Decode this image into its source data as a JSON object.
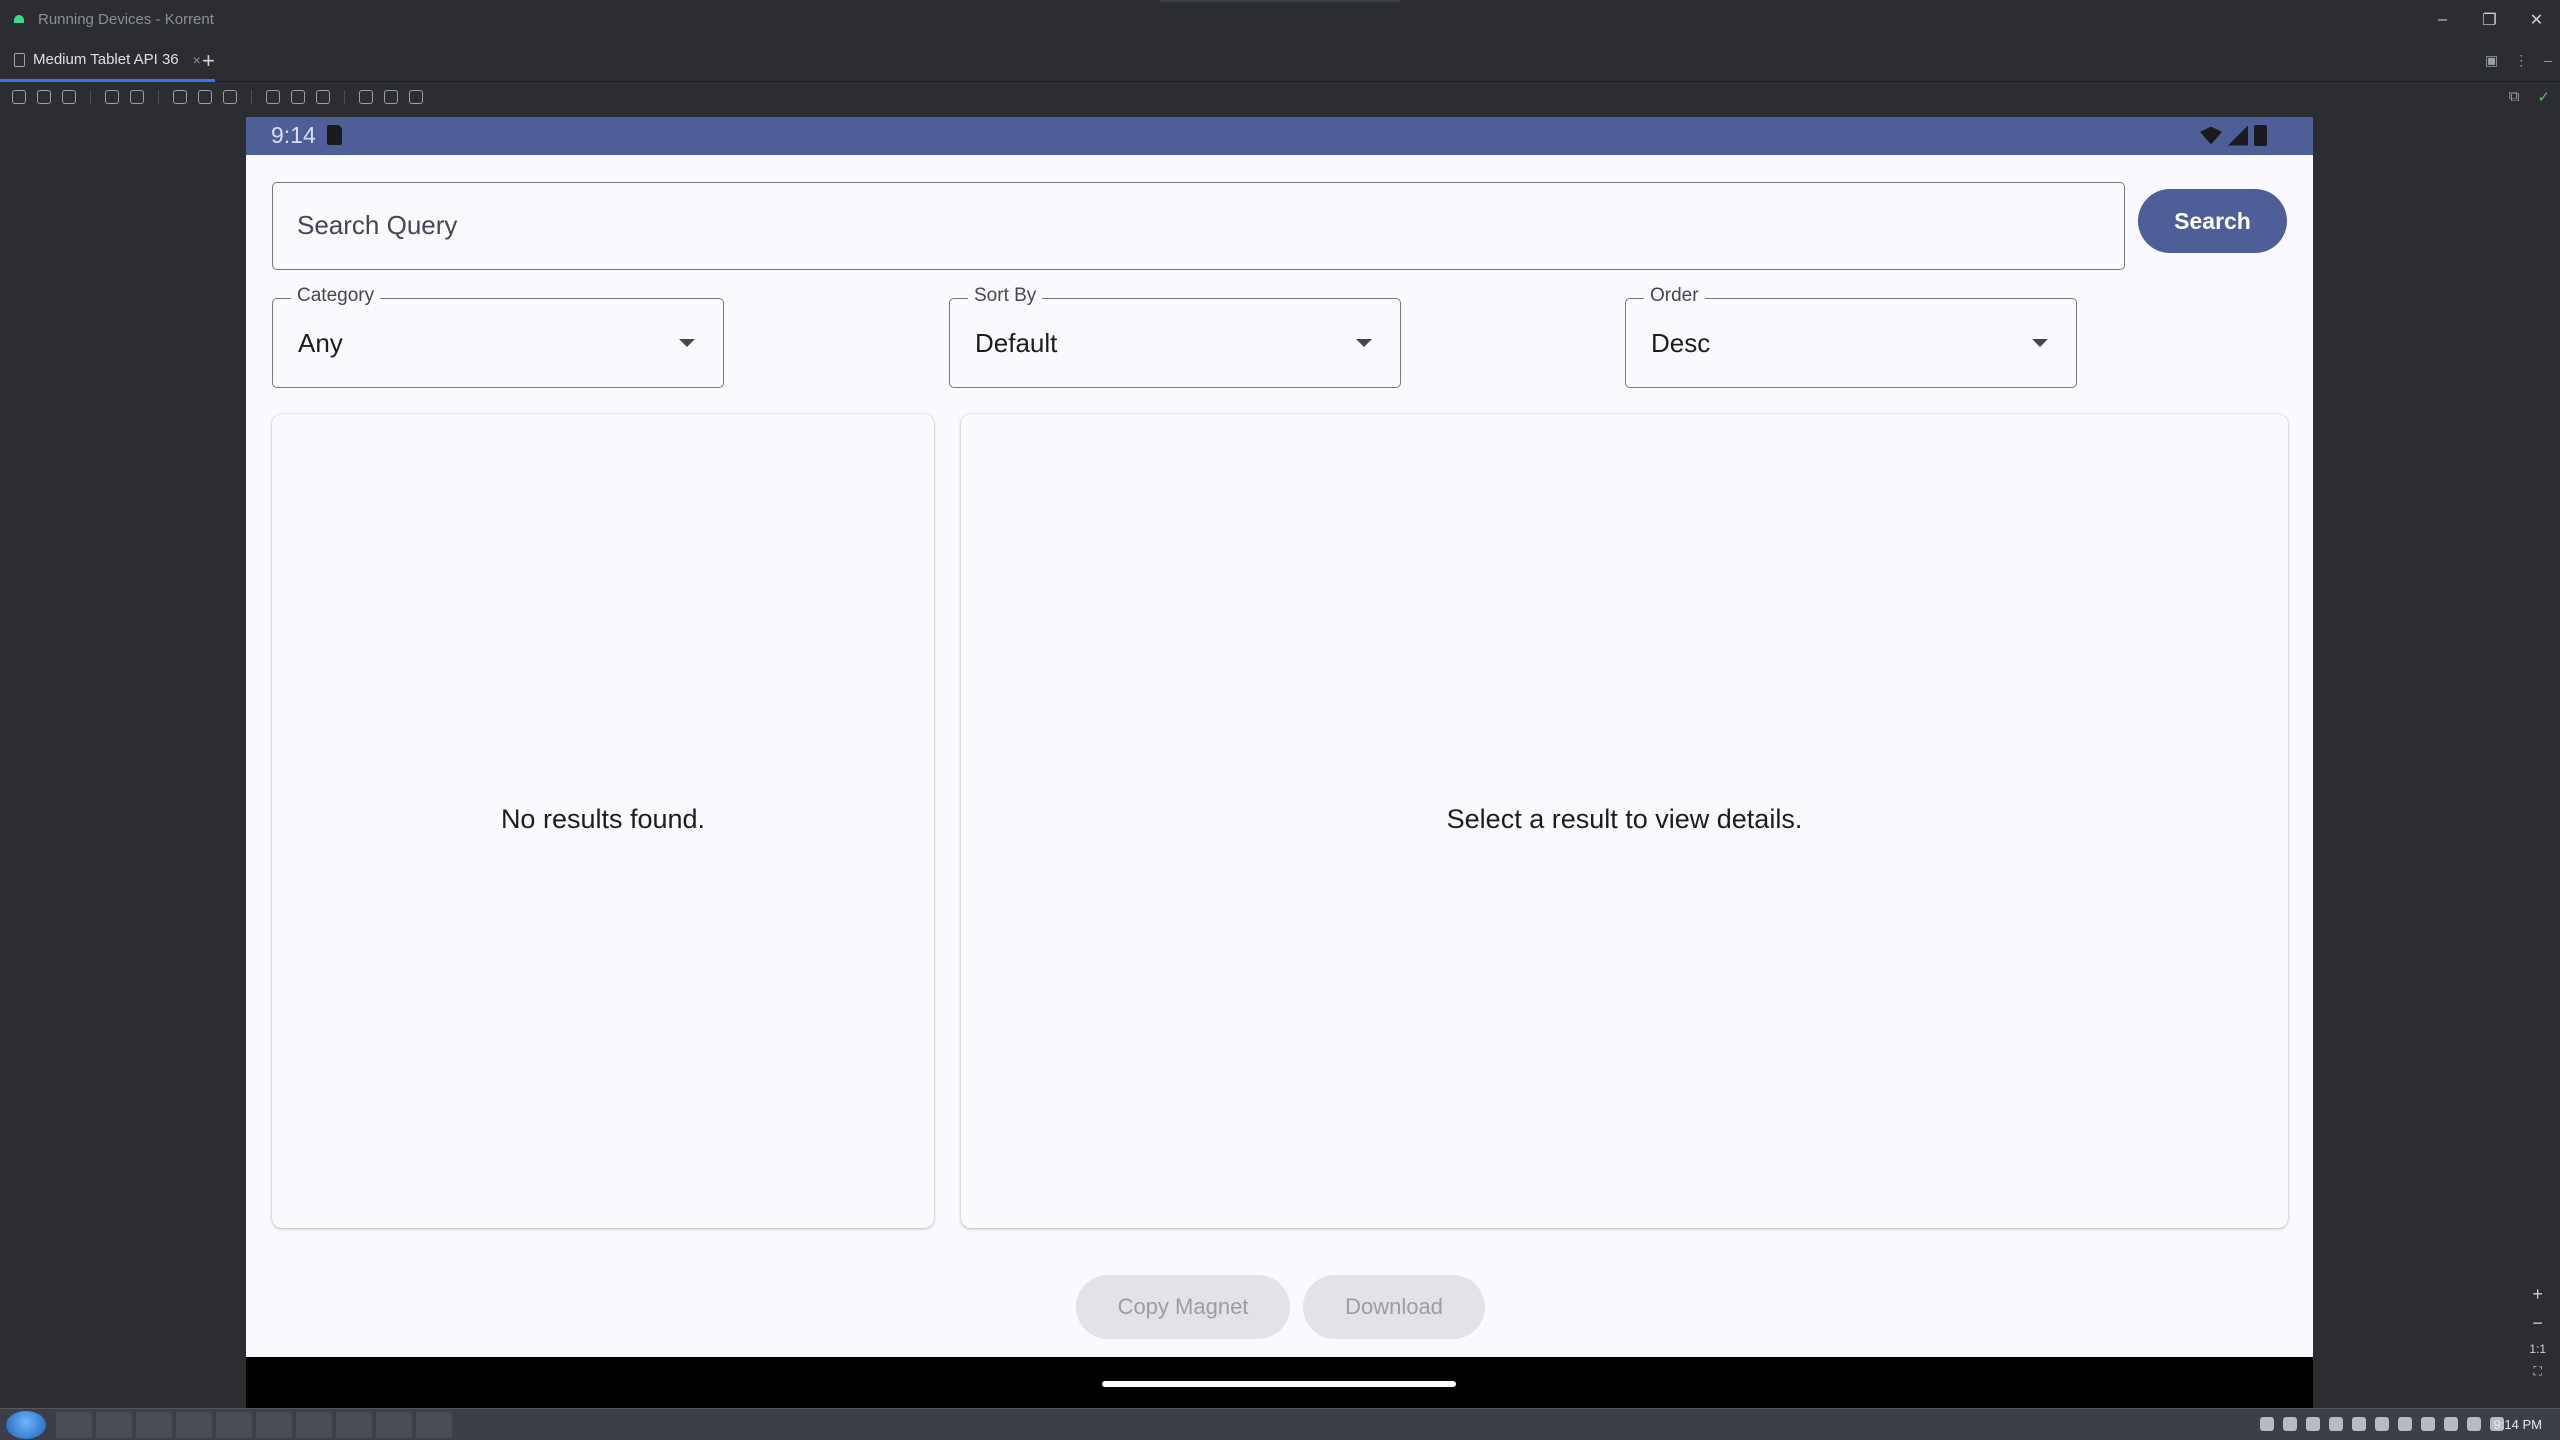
{
  "window": {
    "title": "Running Devices - Korrent",
    "minimize": "–",
    "restore": "❐",
    "close": "✕"
  },
  "tabs": [
    {
      "label": "Medium Tablet API 36",
      "close": "×"
    }
  ],
  "tab_add": "+",
  "ide_right_icons": {
    "a": "▣",
    "b": "⋮",
    "c": "–"
  },
  "toolbar_right": {
    "a": "⧉",
    "b": "✓"
  },
  "device": {
    "status": {
      "time": "9:14"
    },
    "search": {
      "placeholder": "Search Query",
      "value": "",
      "button": "Search"
    },
    "filters": {
      "category": {
        "label": "Category",
        "value": "Any"
      },
      "sort_by": {
        "label": "Sort By",
        "value": "Default"
      },
      "order": {
        "label": "Order",
        "value": "Desc"
      }
    },
    "results_panel": {
      "message": "No results found."
    },
    "details_panel": {
      "message": "Select a result to view details."
    },
    "actions": {
      "copy_magnet": "Copy Magnet",
      "download": "Download"
    }
  },
  "zoom": {
    "in": "+",
    "out": "−",
    "one_to_one": "1:1"
  },
  "taskbar": {
    "clock": "9:14 PM"
  },
  "colors": {
    "accent": "#4e5e97",
    "surface": "#f9f9ff",
    "ide_background": "#2b2d30",
    "disabled_button": "#e2e2e8"
  }
}
